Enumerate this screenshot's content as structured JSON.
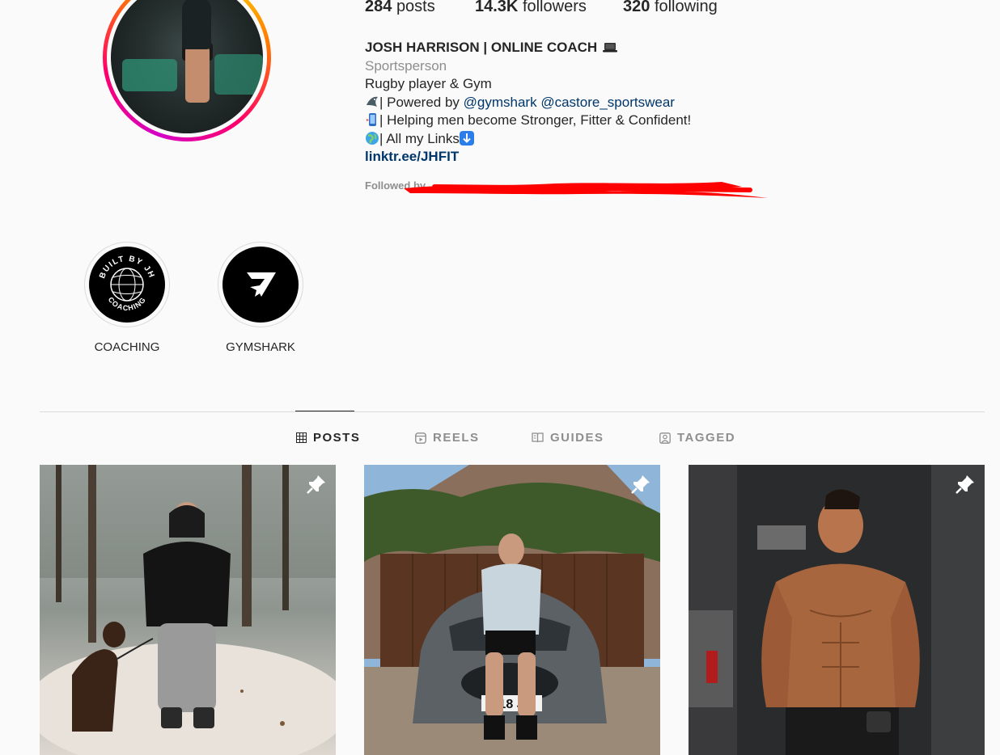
{
  "profile": {
    "stats": {
      "posts_count": "284",
      "posts_label": "posts",
      "followers_count": "14.3K",
      "followers_label": "followers",
      "following_count": "320",
      "following_label": "following"
    },
    "name": "JOSH HARRISON | ONLINE COACH",
    "category": "Sportsperson",
    "bio_line1": "Rugby player & Gym",
    "bio_line2_prefix": "| Powered by ",
    "mention1": "@gymshark",
    "mention2": "@castore_sportswear",
    "bio_line3": "| Helping men become Stronger, Fitter & Confident!",
    "bio_line4": "| All my Links",
    "link": "linktr.ee/JHFIT",
    "followed_by": "Followed by",
    "icons": [
      "laptop-icon",
      "shark-icon",
      "phone-icon",
      "globe-icon",
      "down-arrow-icon"
    ]
  },
  "highlights": [
    {
      "label": "COACHING",
      "badge_text": "BUILT BY JH",
      "badge_subtext": "COACHING"
    },
    {
      "label": "GYMSHARK"
    }
  ],
  "tabs": [
    {
      "label": "POSTS",
      "icon": "grid-icon",
      "active": true
    },
    {
      "label": "REELS",
      "icon": "reels-icon",
      "active": false
    },
    {
      "label": "GUIDES",
      "icon": "guides-icon",
      "active": false
    },
    {
      "label": "TAGGED",
      "icon": "tagged-icon",
      "active": false
    }
  ],
  "posts": [
    {
      "pinned": true,
      "scene": "man with dog in snowy forest"
    },
    {
      "pinned": true,
      "scene": "man sitting on car bonnet",
      "plate": "18 J"
    },
    {
      "pinned": true,
      "scene": "shirtless mirror photo in gym"
    }
  ],
  "colors": {
    "link": "#00376b",
    "muted": "#8e8e8e",
    "redaction": "#ff0000"
  }
}
